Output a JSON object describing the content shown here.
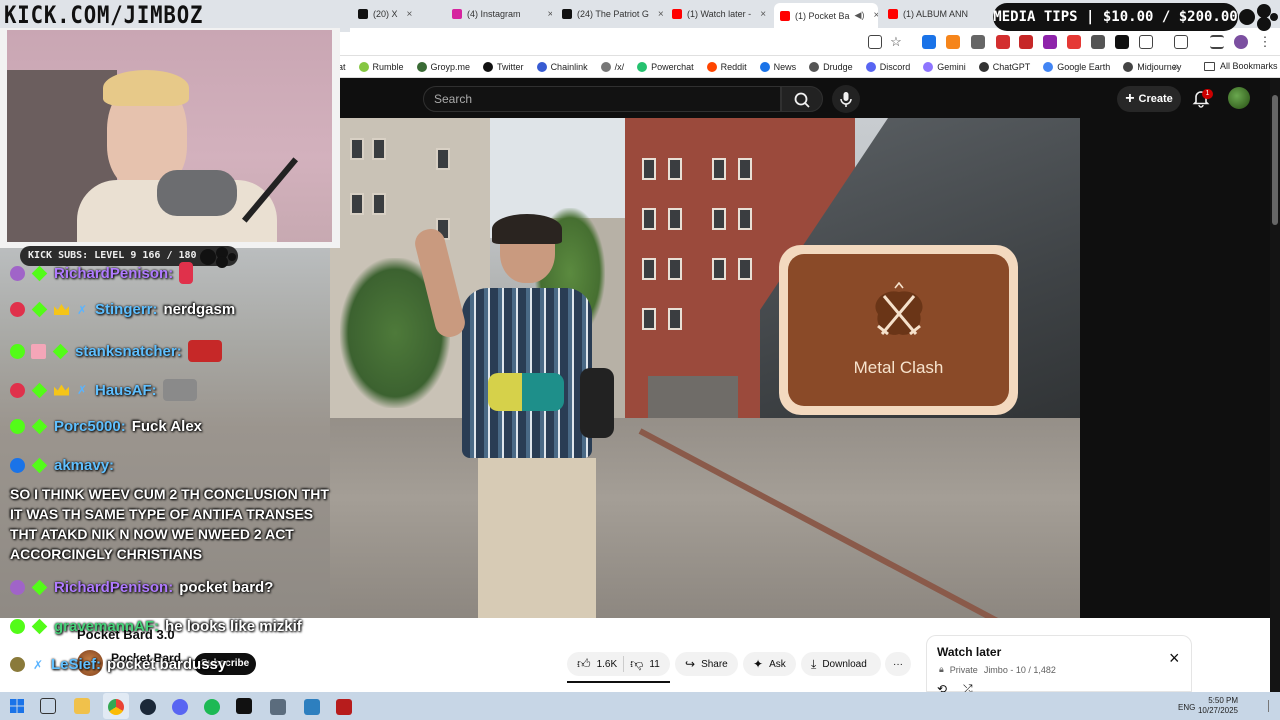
{
  "overlay": {
    "logo_text": "KICK.COM/JIMBOZ",
    "media_tips": "MEDIA TIPS | $10.00 / $200.00",
    "kick_subs": "KICK SUBS: LEVEL 9 166 / 180"
  },
  "browser": {
    "tabs": [
      {
        "label": "(20) X",
        "close": "×",
        "color": "#111111"
      },
      {
        "label": "(4) Instagram",
        "close": "×",
        "color": "#d6249f"
      },
      {
        "label": "(24) The Patriot G",
        "close": "×",
        "color": "#111111"
      },
      {
        "label": "(1) Watch later -",
        "close": "×",
        "color": "#ff0000"
      },
      {
        "label": "(1) Pocket Ba",
        "close": "×",
        "color": "#ff0000"
      },
      {
        "label": "(1) ALBUM ANN",
        "close": "×",
        "color": "#ff0000"
      }
    ],
    "bookmarks": [
      {
        "label": "at",
        "color": "#999999"
      },
      {
        "label": "Rumble",
        "color": "#85c742"
      },
      {
        "label": "Groyp.me",
        "color": "#3a6b35"
      },
      {
        "label": "Twitter",
        "color": "#111111"
      },
      {
        "label": "Chainlink",
        "color": "#375bd2"
      },
      {
        "label": "/x/",
        "color": "#777777"
      },
      {
        "label": "Powerchat",
        "color": "#25c16f"
      },
      {
        "label": "Reddit",
        "color": "#ff4500"
      },
      {
        "label": "News",
        "color": "#1a73e8"
      },
      {
        "label": "Drudge",
        "color": "#555555"
      },
      {
        "label": "Discord",
        "color": "#5865f2"
      },
      {
        "label": "Gemini",
        "color": "#8e75ff"
      },
      {
        "label": "ChatGPT",
        "color": "#333333"
      },
      {
        "label": "Google Earth",
        "color": "#4285f4"
      },
      {
        "label": "Midjourney",
        "color": "#444444"
      }
    ],
    "bookmarks_more": "»",
    "all_bookmarks": "All Bookmarks"
  },
  "youtube": {
    "search_placeholder": "Search",
    "create_label": "Create",
    "notification_count": "1",
    "video_overlay_card": "Metal Clash",
    "video_title": "Pocket Bard 3.0",
    "channel_name": "Pocket Bard",
    "subscribe_label": "Subscribe",
    "likes": "1.6K",
    "dislikes": "11",
    "share_label": "Share",
    "ask_label": "Ask",
    "download_label": "Download",
    "more_label": "···",
    "watch_later_title": "Watch later",
    "watch_later_privacy": "Private",
    "watch_later_meta": "Jimbo - 10 / 1,482",
    "close_label": "×"
  },
  "chat": {
    "messages": [
      {
        "user": "RichardPenison:",
        "text": "",
        "color": "purple"
      },
      {
        "user": "Stingerr:",
        "text": "nerdgasm",
        "color": "blue"
      },
      {
        "user": "stanksnatcher:",
        "text": "",
        "color": "blue"
      },
      {
        "user": "HausAF:",
        "text": "",
        "color": "blue"
      },
      {
        "user": "Porc5000:",
        "text": "Fuck Alex",
        "color": "blue"
      },
      {
        "user": "akmavy:",
        "text": "",
        "color": "blue"
      },
      {
        "user": "RichardPenison:",
        "text": "pocket bard?",
        "color": "purple"
      },
      {
        "user": "gravemannAF:",
        "text": "he looks like mizkif",
        "color": "green"
      },
      {
        "user": "LeSief:",
        "text": "pocket bardussy",
        "color": "blue"
      }
    ],
    "long_message": "SO I THINK WEEV CUM 2 TH CONCLUSION THT IT WAS TH SAME TYPE OF ANTIFA TRANSES THT ATAKD NIK N NOW WE NWEED 2 ACT ACCORCINGLY CHRISTIANS"
  },
  "taskbar": {
    "language": "ENG",
    "time": "5:50 PM",
    "date": "10/27/2025"
  }
}
